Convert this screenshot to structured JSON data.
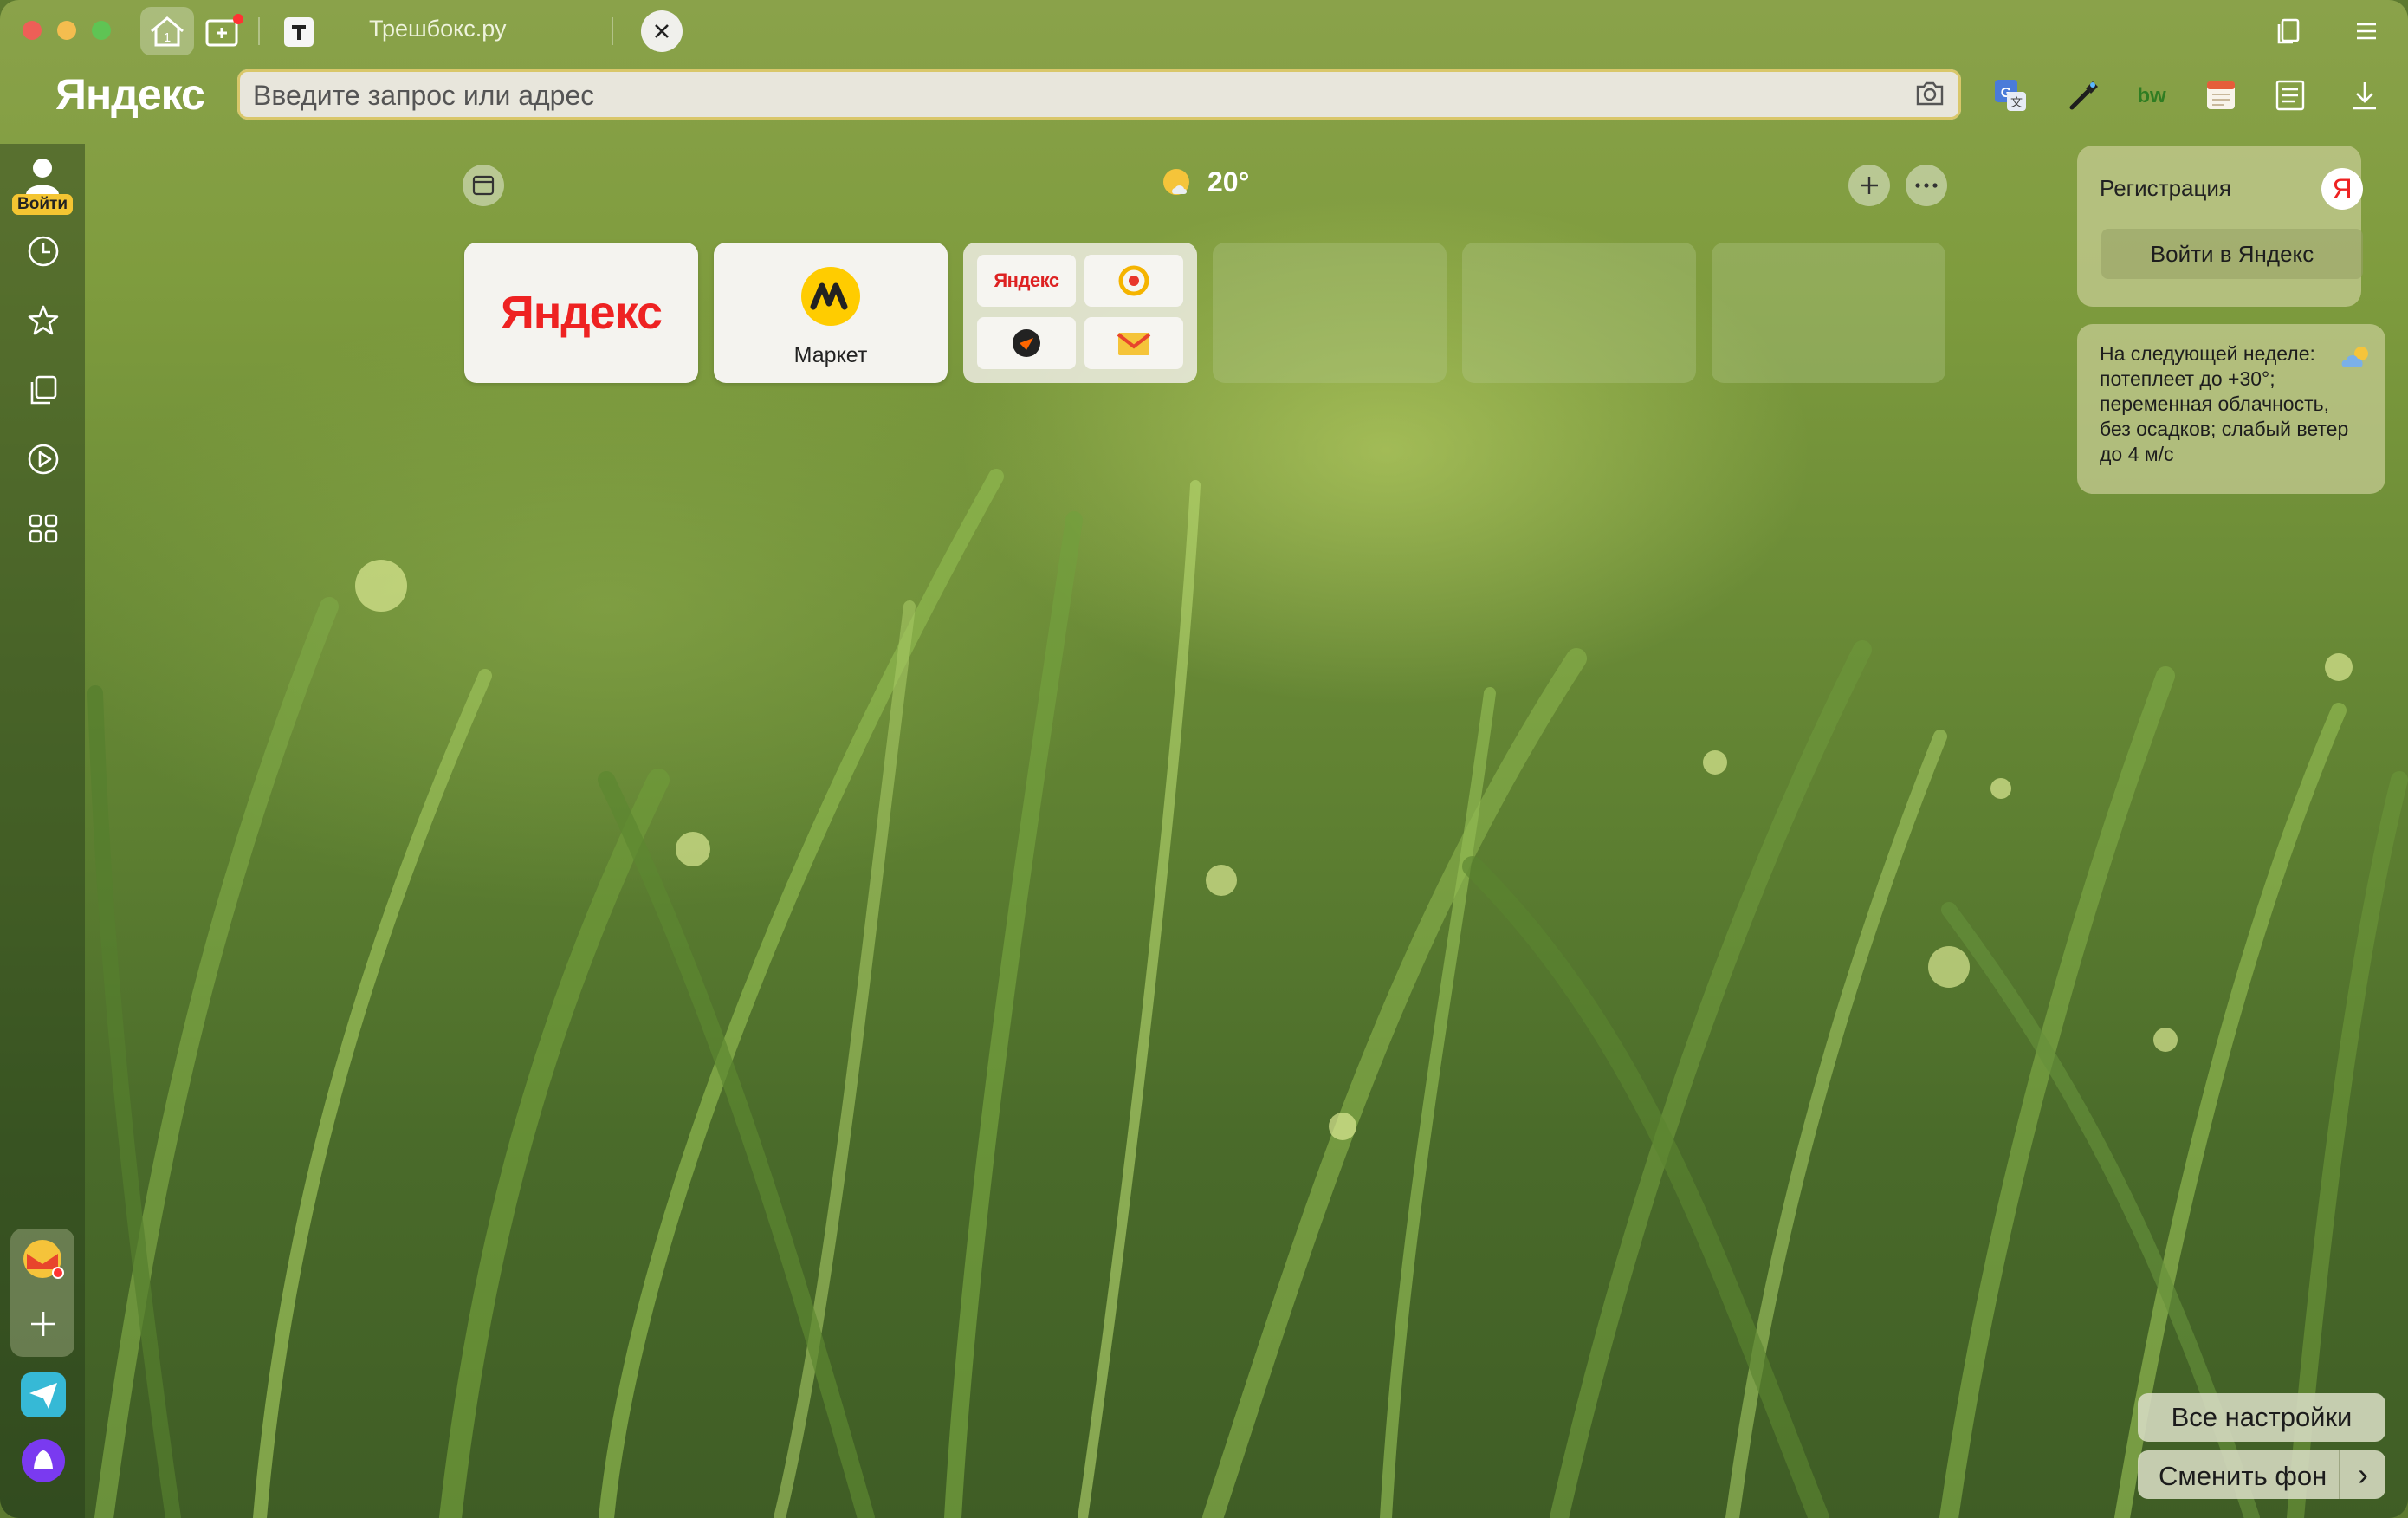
{
  "window": {
    "tab_counter": "1",
    "active_tab_title": "Трешбокс.ру"
  },
  "toolbar": {
    "logo": "Яндекс",
    "search_placeholder": "Введите запрос или адрес"
  },
  "sidebar": {
    "login_label": "Войти"
  },
  "weather": {
    "temperature": "20°"
  },
  "tiles": {
    "yandex_logo": "Яндекс",
    "market_label": "Маркет",
    "group_yandex_label": "Яндекс"
  },
  "panel": {
    "registration_label": "Регистрация",
    "ya_badge": "Я",
    "login_button": "Войти в Яндекс",
    "forecast_text": "На следующей неделе: потеплеет до +30°; переменная облачность, без осадков; слабый ветер до 4 м/с"
  },
  "bottom": {
    "all_settings": "Все настройки",
    "change_bg": "Сменить фон",
    "arrow": "›"
  },
  "colors": {
    "accent_red": "#f33",
    "market_yellow": "#ffcc00",
    "address_border": "#d9c76a"
  }
}
